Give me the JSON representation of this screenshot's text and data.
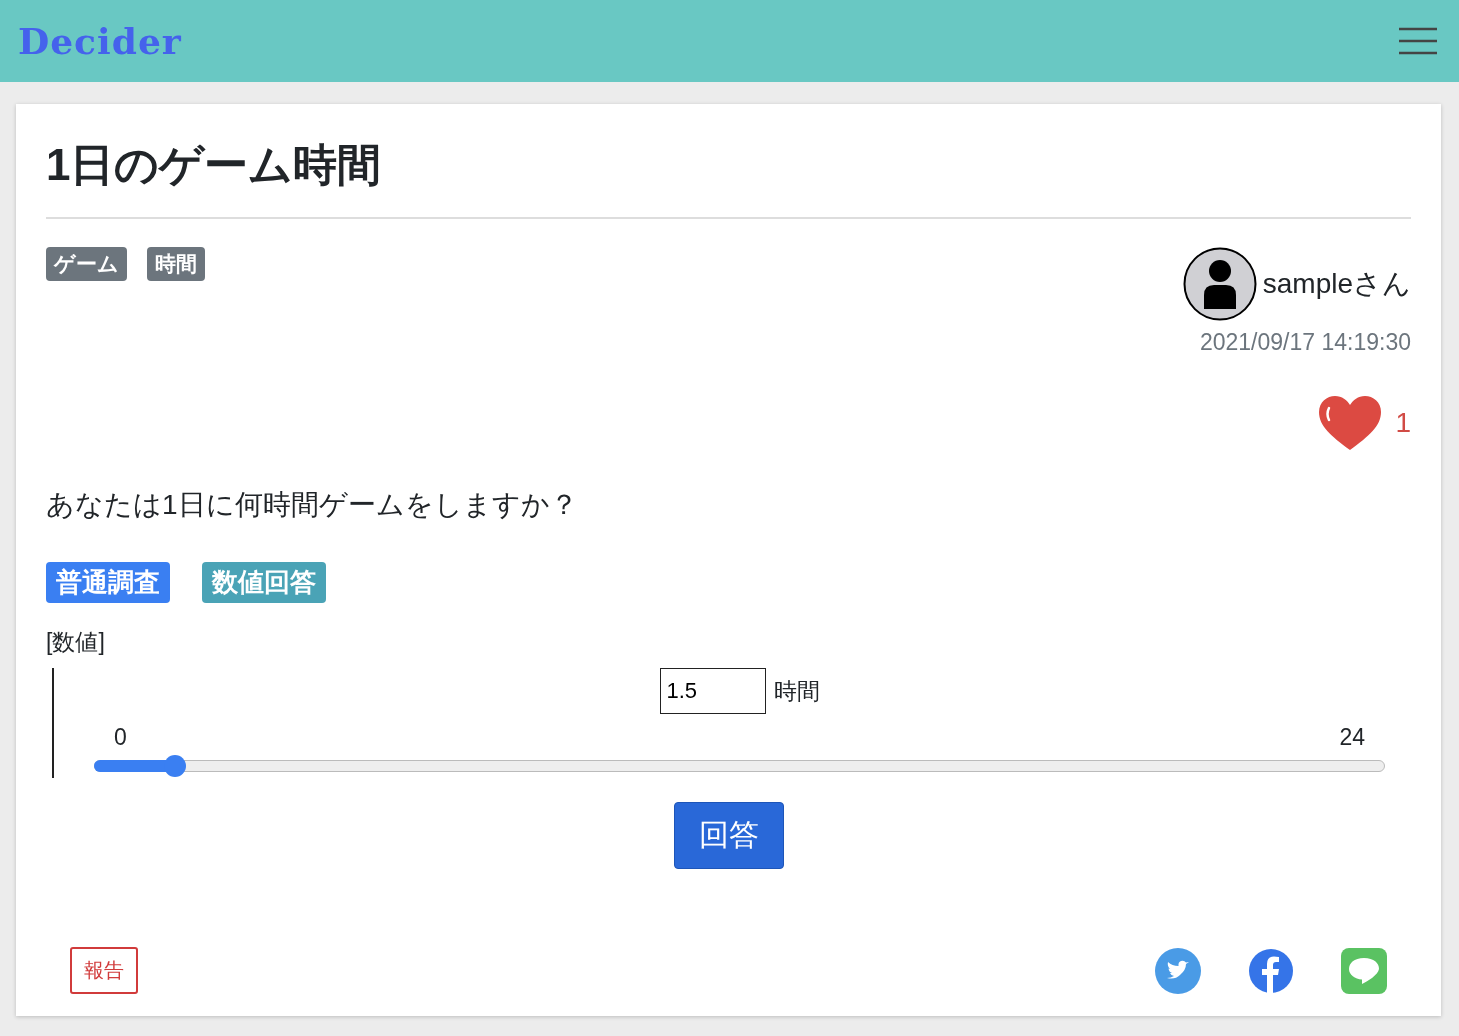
{
  "header": {
    "logo": "Decider"
  },
  "question": {
    "title": "1日のゲーム時間",
    "tags": [
      "ゲーム",
      "時間"
    ],
    "author": {
      "name": "sampleさん",
      "posted_at": "2021/09/17 14:19:30"
    },
    "likes": {
      "count": "1"
    },
    "body": "あなたは1日に何時間ゲームをしますか？",
    "badges": [
      {
        "label": "普通調査",
        "color": "#3a7ff2"
      },
      {
        "label": "数値回答",
        "color": "#4aa3b6"
      }
    ],
    "answer": {
      "label": "[数値]",
      "value": "1.5",
      "unit": "時間",
      "min": "0",
      "max": "24",
      "level": 0.0625
    },
    "submit": "回答",
    "report": "報告"
  }
}
